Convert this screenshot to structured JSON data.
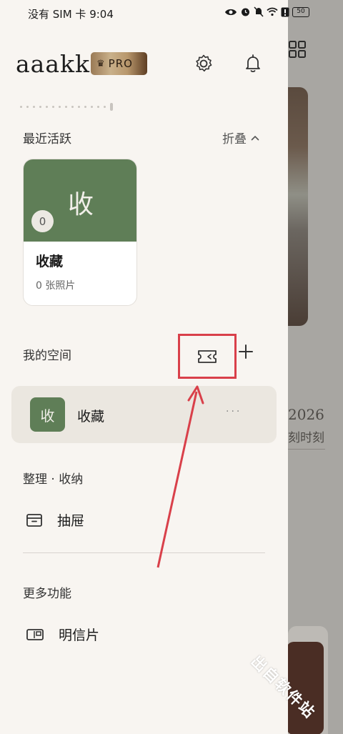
{
  "status_bar": {
    "carrier_time": "没有 SIM 卡 9:04",
    "battery": "50"
  },
  "header": {
    "brand": "aaakk",
    "pro_badge": "PRO",
    "pro_icon": "crown-icon"
  },
  "recent": {
    "title": "最近活跃",
    "fold_label": "折叠",
    "album": {
      "cover_char": "收",
      "count": "0",
      "name": "收藏",
      "photo_count": "0 张照片"
    }
  },
  "my_space": {
    "title": "我的空间",
    "items": [
      {
        "thumb_char": "收",
        "name": "收藏",
        "more": "···"
      }
    ]
  },
  "organize": {
    "title": "整理 · 收纳",
    "drawer_label": "抽屉"
  },
  "more_features": {
    "title": "更多功能",
    "postcard_label": "明信片"
  },
  "background": {
    "text1": "2026",
    "text2": "刻时刻"
  },
  "watermark": "出自软件站",
  "colors": {
    "accent_green": "#5f7e57",
    "highlight_red": "#d9404a",
    "drawer_bg": "#f8f5f1"
  }
}
